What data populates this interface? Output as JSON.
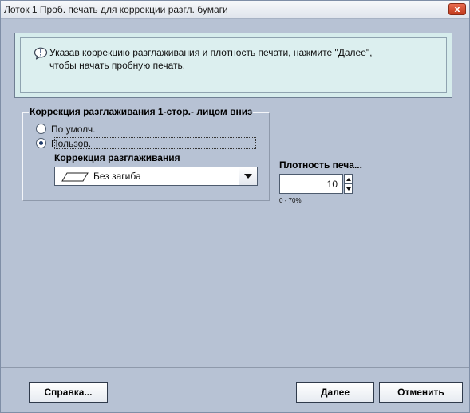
{
  "window": {
    "title": "Лоток 1 Проб. печать для коррекции разгл. бумаги",
    "close_label": "x"
  },
  "info": {
    "icon": "chat-info-icon",
    "line1": "Указав коррекцию разглаживания и плотность печати, нажмите \"Далее\",",
    "line2": "чтобы начать пробную печать."
  },
  "decurl_group": {
    "title": "Коррекция разглаживания 1-стор.- лицом вниз",
    "option_default": "По умолч.",
    "option_custom": "Пользов.",
    "selected": "custom",
    "correction_label": "Коррекция разглаживания",
    "correction_value": "Без загиба",
    "correction_icon": "flat-sheet-icon"
  },
  "density": {
    "label": "Плотность печа...",
    "value": "10",
    "range": "0 - 70%"
  },
  "buttons": {
    "help": "Справка...",
    "next": "Далее",
    "cancel": "Отменить"
  }
}
